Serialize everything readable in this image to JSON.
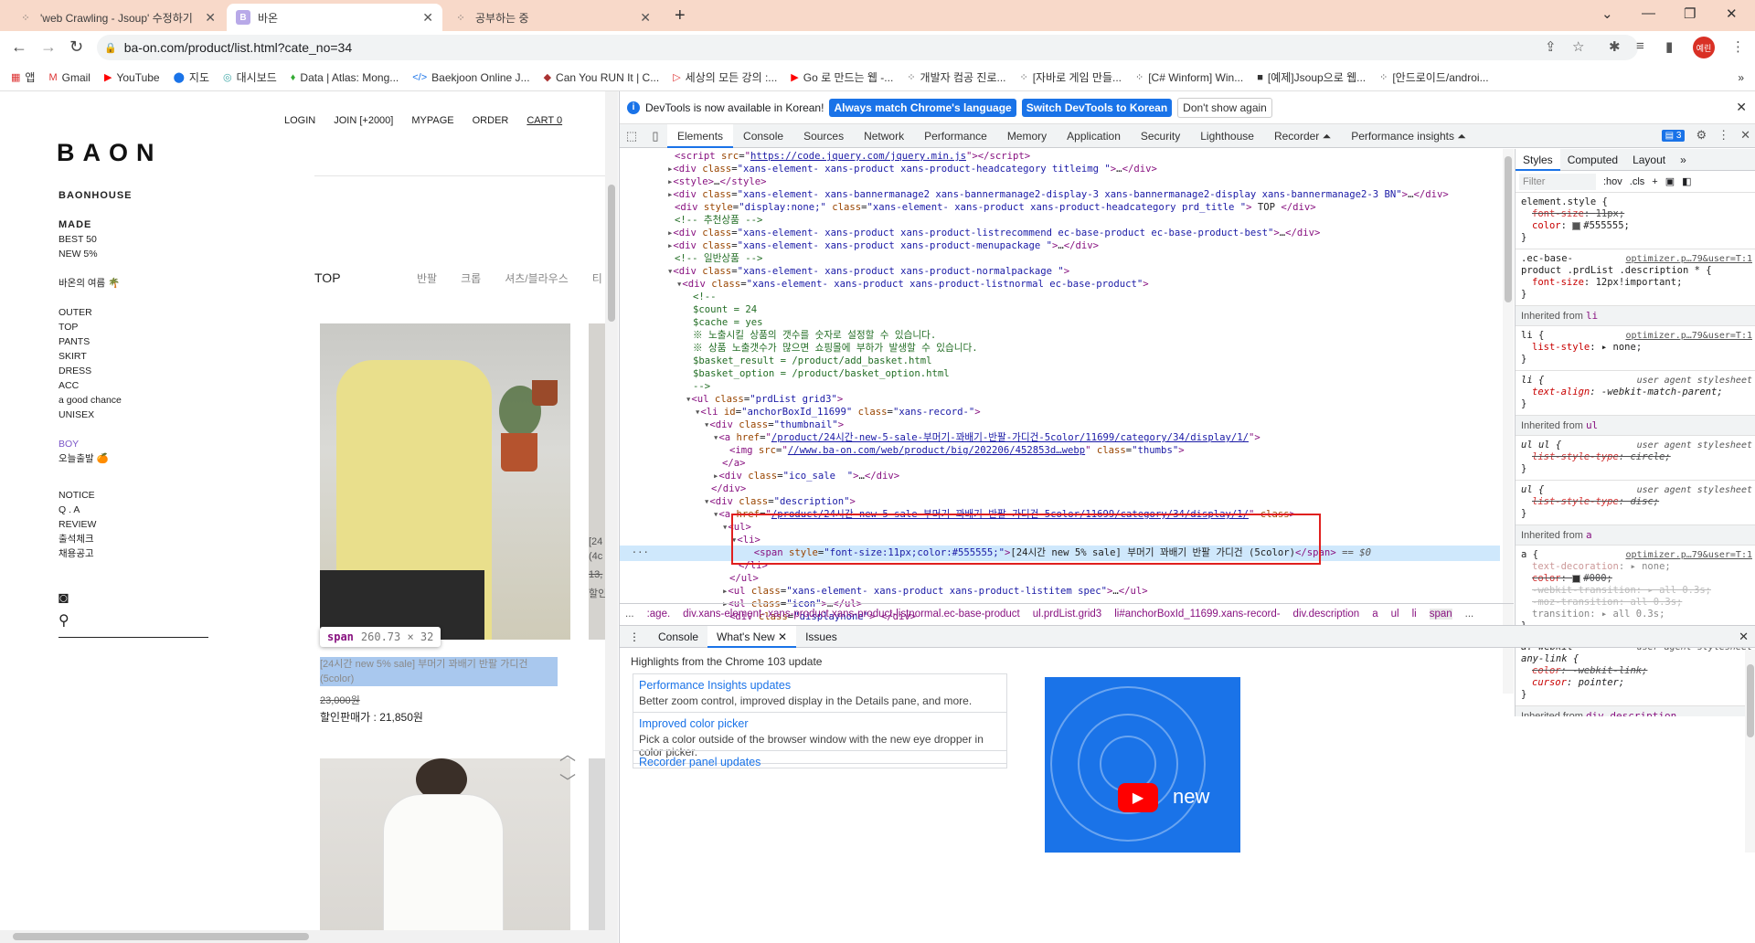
{
  "browser": {
    "tabs": [
      {
        "title": "'web Crawling - Jsoup' 수정하기",
        "icon": "tistory-icon"
      },
      {
        "title": "바온",
        "icon": "baon-icon",
        "favicon_text": "B"
      },
      {
        "title": "공부하는 중",
        "icon": "tistory-icon"
      }
    ],
    "url": "ba-on.com/product/list.html?cate_no=34",
    "profile": "예린",
    "bookmarks": [
      "앱",
      "Gmail",
      "YouTube",
      "지도",
      "대시보드",
      "Data | Atlas: Mong...",
      "Baekjoon Online J...",
      "Can You RUN It | C...",
      "세상의 모든 강의 :...",
      "Go 로 만드는 웹 -...",
      "개발자 컴공 진로...",
      "[자바로 게임 만들...",
      "[C# Winform] Win...",
      "[예제]Jsoup으로 웹...",
      "[안드로이드/androi..."
    ]
  },
  "site": {
    "logo": "BAON",
    "topnav": [
      "LOGIN",
      "JOIN [+2000]",
      "MYPAGE",
      "ORDER",
      "CART 0"
    ],
    "sidebar": {
      "brand": "BAONHOUSE",
      "made": "MADE",
      "best": "BEST 50",
      "new": "NEW 5%",
      "summer": "바온의 여름 🌴",
      "categories": [
        "OUTER",
        "TOP",
        "PANTS",
        "SKIRT",
        "DRESS",
        "ACC",
        "a good chance",
        "UNISEX"
      ],
      "boy": "BOY",
      "boy_sub": "오늘출발 🍊",
      "board": [
        "NOTICE",
        "Q . A",
        "REVIEW",
        "출석체크",
        "채용공고"
      ]
    },
    "category_title": "TOP",
    "subcategories": [
      "반팔",
      "크롭",
      "셔츠/블라우스",
      "티"
    ],
    "tooltip": {
      "tag": "span",
      "size": "260.73 × 32"
    },
    "product1": {
      "name_line1": "[24시간 new 5% sale] 부머기 꽈배기 반팔 가디건",
      "name_line2": "(5color)",
      "price": "23,000원",
      "sale": "할인판매가 : 21,850원"
    },
    "product2": {
      "name_line1": "[24",
      "name_line2": "(4c",
      "price": "13,",
      "sale": "할인"
    }
  },
  "devtools": {
    "infobar": {
      "message": "DevTools is now available in Korean!",
      "btn_match": "Always match Chrome's language",
      "btn_switch": "Switch DevTools to Korean",
      "btn_dismiss": "Don't show again"
    },
    "tabs": [
      "Elements",
      "Console",
      "Sources",
      "Network",
      "Performance",
      "Memory",
      "Application",
      "Security",
      "Lighthouse",
      "Recorder ⏶",
      "Performance insights ⏶"
    ],
    "issues_count": "3",
    "breadcrumb": [
      "...",
      ":age.",
      "div.xans-element-.xans-product.xans-product-listnormal.ec-base-product",
      "ul.prdList.grid3",
      "li#anchorBoxId_11699.xans-record-",
      "div.description",
      "a",
      "ul",
      "li",
      "span",
      "..."
    ],
    "styles_tabs": [
      "Styles",
      "Computed",
      "Layout",
      "»"
    ],
    "filter": {
      "placeholder": "Filter",
      "hov": ":hov",
      "cls": ".cls"
    },
    "inherited_label": "Inherited from",
    "drawer_tabs": [
      "Console",
      "What's New",
      "Issues"
    ],
    "whats_new": {
      "highlight": "Highlights from the Chrome 103 update",
      "cards": [
        {
          "title": "Performance Insights updates",
          "desc": "Better zoom control, improved display in the Details pane, and more."
        },
        {
          "title": "Improved color picker",
          "desc": "Pick a color outside of the browser window with the new eye dropper in color picker."
        },
        {
          "title": "Recorder panel updates",
          "desc": ""
        }
      ],
      "banner_text": "new"
    }
  },
  "colors": {
    "tabstrip": "#f8d9c9",
    "accent": "#1a73e8",
    "highlight": "#e0201f"
  }
}
